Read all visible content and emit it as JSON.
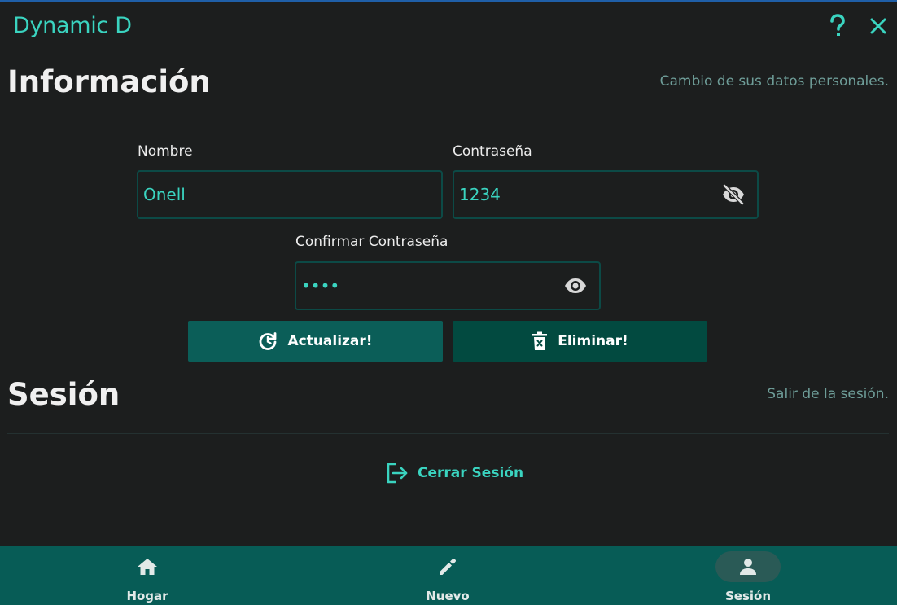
{
  "app": {
    "title": "Dynamic D"
  },
  "titlebar": {
    "help_icon": "help-icon",
    "close_icon": "close-icon"
  },
  "info_section": {
    "title": "Información",
    "subtitle": "Cambio de sus datos personales."
  },
  "form": {
    "name_label": "Nombre",
    "name_value": "Onell",
    "password_label": "Contraseña",
    "password_value": "1234",
    "password_toggle_icon": "eye-off-icon",
    "confirm_label": "Confirmar Contraseña",
    "confirm_value": "1234",
    "confirm_toggle_icon": "eye-icon"
  },
  "actions": {
    "update_label": "Actualizar!",
    "update_icon": "refresh-icon",
    "delete_label": "Eliminar!",
    "delete_icon": "trash-icon"
  },
  "session_section": {
    "title": "Sesión",
    "subtitle": "Salir de la sesión.",
    "logout_label": "Cerrar Sesión",
    "logout_icon": "logout-icon"
  },
  "bottom_nav": {
    "items": [
      {
        "label": "Hogar",
        "icon": "home-icon",
        "active": false
      },
      {
        "label": "Nuevo",
        "icon": "pencil-icon",
        "active": false
      },
      {
        "label": "Sesión",
        "icon": "person-icon",
        "active": true
      }
    ]
  },
  "colors": {
    "accent": "#3ad4c0",
    "background": "#1c1e1e",
    "nav_background": "#075c56",
    "update_button": "#0b5e58",
    "delete_button": "#024a40",
    "window_border": "#1f5fa8"
  }
}
